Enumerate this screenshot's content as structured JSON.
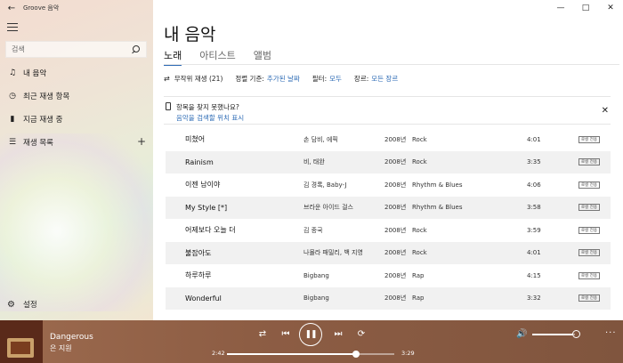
{
  "app": {
    "title": "Groove 음악"
  },
  "search": {
    "placeholder": "검색"
  },
  "nav": {
    "items": [
      {
        "label": "내 음악",
        "icon": "music-note-icon"
      },
      {
        "label": "최근 재생 항목",
        "icon": "clock-icon"
      },
      {
        "label": "지금 재생 중",
        "icon": "bars-icon"
      },
      {
        "label": "재생 목록",
        "icon": "list-icon"
      }
    ],
    "settings": "설정"
  },
  "main": {
    "title": "내 음악",
    "tabs": [
      "노래",
      "아티스트",
      "앨범"
    ],
    "active_tab": "노래"
  },
  "toolbar": {
    "shuffle": "무작위 재생 (21)",
    "sort_label": "정렬 기준:",
    "sort_value": "추가된 날짜",
    "filter_label": "필터:",
    "filter_value": "모두",
    "genre_label": "장르:",
    "genre_value": "모든 장르"
  },
  "notice": {
    "title": "항목을 찾지 못했나요?",
    "link": "음악을 검색할 위치 표시"
  },
  "songs": [
    {
      "title": "미쳤어",
      "artist": "손 담비, 에픽",
      "year": "2008년",
      "genre": "Rock",
      "duration": "4:01"
    },
    {
      "title": "Rainism",
      "artist": "비, 태완",
      "year": "2008년",
      "genre": "Rock",
      "duration": "3:35"
    },
    {
      "title": "이젠 남이야",
      "artist": "김 경록, Baby-J",
      "year": "2008년",
      "genre": "Rhythm & Blues",
      "duration": "4:06"
    },
    {
      "title": "My Style [*]",
      "artist": "브라운 아이드 걸스",
      "year": "2008년",
      "genre": "Rhythm & Blues",
      "duration": "3:58"
    },
    {
      "title": "어제보다 오늘 더",
      "artist": "김 종국",
      "year": "2008년",
      "genre": "Rock",
      "duration": "3:59"
    },
    {
      "title": "불잡아도",
      "artist": "나몰라 패밀리, 백 지영",
      "year": "2008년",
      "genre": "Rock",
      "duration": "4:01"
    },
    {
      "title": "하루하루",
      "artist": "Bigbang",
      "year": "2008년",
      "genre": "Rap",
      "duration": "4:15"
    },
    {
      "title": "Wonderful",
      "artist": "Bigbang",
      "year": "2008년",
      "genre": "Rap",
      "duration": "3:32"
    }
  ],
  "song_badge": "로컬 전용",
  "player": {
    "title": "Dangerous",
    "artist": "은 지원",
    "elapsed": "2:42",
    "total": "3:29",
    "progress": 0.77,
    "volume": 0.94
  },
  "colors": {
    "accent": "#2d6bb5",
    "player_bg": "#8d5d44"
  }
}
